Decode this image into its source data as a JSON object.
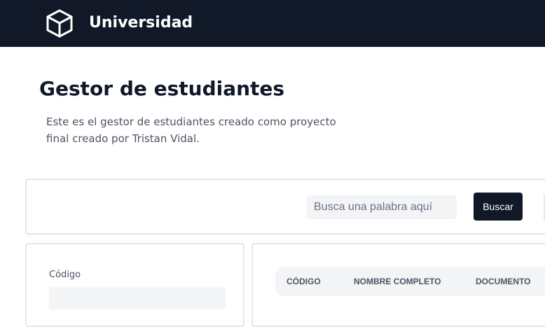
{
  "header": {
    "brand": "Universidad",
    "logo_icon": "cube-icon",
    "background_color": "#111827"
  },
  "main": {
    "title": "Gestor de estudiantes",
    "description": "Este es el gestor de estudiantes creado como proyecto final creado por Tristan Vidal."
  },
  "search": {
    "placeholder": "Busca una palabra aquí",
    "value": "",
    "button_label": "Buscar"
  },
  "form": {
    "code_label": "Código",
    "code_value": ""
  },
  "table": {
    "columns": [
      "CÓDIGO",
      "NOMBRE COMPLETO",
      "DOCUMENTO"
    ]
  },
  "colors": {
    "primary": "#111827",
    "input_background": "#f3f4f6",
    "border": "#e5e7eb"
  }
}
